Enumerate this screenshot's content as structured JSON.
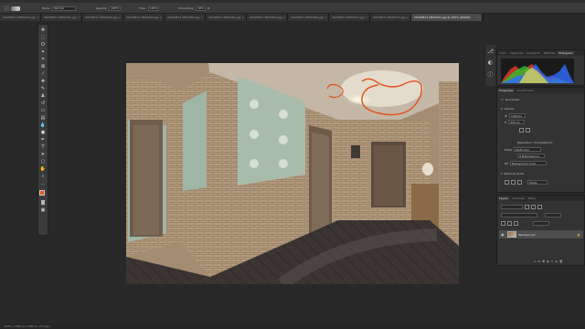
{
  "options": {
    "mode_label": "Mode:",
    "mode_value": "Normal",
    "opacity_label": "Opacity:",
    "opacity_value": "100%",
    "flow_label": "Flow:",
    "flow_value": "100%",
    "smoothing_label": "Smoothing:",
    "smoothing_value": "10%"
  },
  "tabs": [
    {
      "label": "20200817-0B20420.jpg"
    },
    {
      "label": "20200817-0B20441.jpg"
    },
    {
      "label": "20200817-0B20444.jpg"
    },
    {
      "label": "20200817-0B20449.jpg"
    },
    {
      "label": "20200817-0B20459.jpg"
    },
    {
      "label": "20200817-0B20461.jpg"
    },
    {
      "label": "20200817-0B20464.jpg"
    },
    {
      "label": "20200817-0B20466.jpg"
    },
    {
      "label": "20200817-0B20472.jpg"
    },
    {
      "label": "20200817-0B20474.jpg"
    },
    {
      "label": "20200817-0B20431.jpg @ 100% (RGB/8)"
    }
  ],
  "hist_panel": {
    "tabs": [
      "Color",
      "Swatches",
      "Gradients",
      "Patterns",
      "Histogram"
    ]
  },
  "props_panel": {
    "tabs": [
      "Properties",
      "Adjustments"
    ],
    "doc_label": "Document",
    "canvas_label": "Canvas",
    "w_label": "W",
    "w_value": "1440 px",
    "h_label": "H",
    "h_value": "955 px",
    "resolution": "Resolution: 72 pixels/inch",
    "mode_label": "Mode",
    "mode_value": "RGB Color",
    "depth_value": "8 Bits/Channel",
    "fill_label": "Fill",
    "fill_value": "Background Color",
    "rulers_label": "Rulers & Grids",
    "units_value": "Pixels"
  },
  "layers_panel": {
    "tabs": [
      "Layers",
      "Channels",
      "Paths"
    ],
    "layer_name": "Background"
  },
  "status_text": "100% | 1440 px x 955 px (72 ppi)",
  "colors": {
    "foreground": "#e2531c",
    "background": "#ffffff"
  },
  "icons": [
    "brush-icon",
    "move-icon",
    "marquee-icon",
    "lasso-icon",
    "crop-icon",
    "eyedropper-icon",
    "healing-icon",
    "stamp-icon",
    "eraser-icon",
    "gradient-icon",
    "pen-icon",
    "text-icon",
    "hand-icon",
    "zoom-icon",
    "eye-icon",
    "lock-icon"
  ]
}
